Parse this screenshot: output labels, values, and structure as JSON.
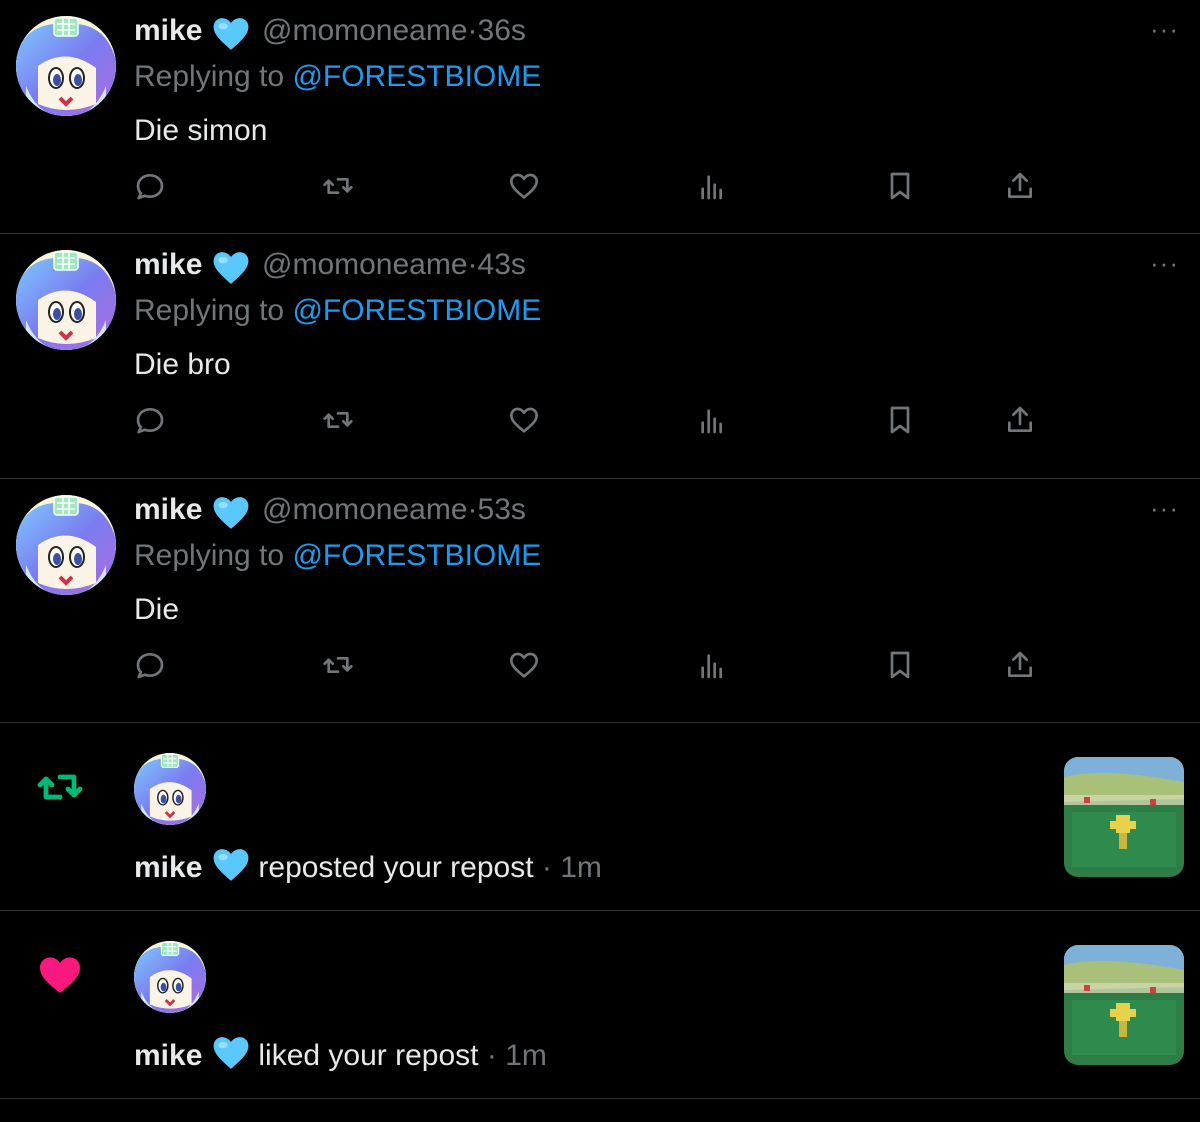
{
  "replies": [
    {
      "name": "mike",
      "handle": "@momoneame",
      "sep": "·",
      "time": "36s",
      "replying_prefix": "Replying to",
      "mention": "@FORESTBIOME",
      "text": "Die simon",
      "more": "···"
    },
    {
      "name": "mike",
      "handle": "@momoneame",
      "sep": "·",
      "time": "43s",
      "replying_prefix": "Replying to",
      "mention": "@FORESTBIOME",
      "text": "Die bro",
      "more": "···"
    },
    {
      "name": "mike",
      "handle": "@momoneame",
      "sep": "·",
      "time": "53s",
      "replying_prefix": "Replying to",
      "mention": "@FORESTBIOME",
      "text": "Die",
      "more": "···"
    }
  ],
  "notifications": [
    {
      "type": "repost",
      "icon": "repost-icon",
      "icon_color": "#00ba7c",
      "name": "mike",
      "action": "reposted your repost",
      "sep": "·",
      "time": "1m"
    },
    {
      "type": "like",
      "icon": "heart-icon",
      "icon_color": "#f91880",
      "name": "mike",
      "action": "liked your repost",
      "sep": "·",
      "time": "1m"
    }
  ],
  "colors": {
    "background": "#000000",
    "link": "#1d9bf0",
    "muted": "#71767b",
    "text": "#e7e9ea",
    "verified_heart": "#5ac8fa",
    "divider": "#2f3336"
  }
}
